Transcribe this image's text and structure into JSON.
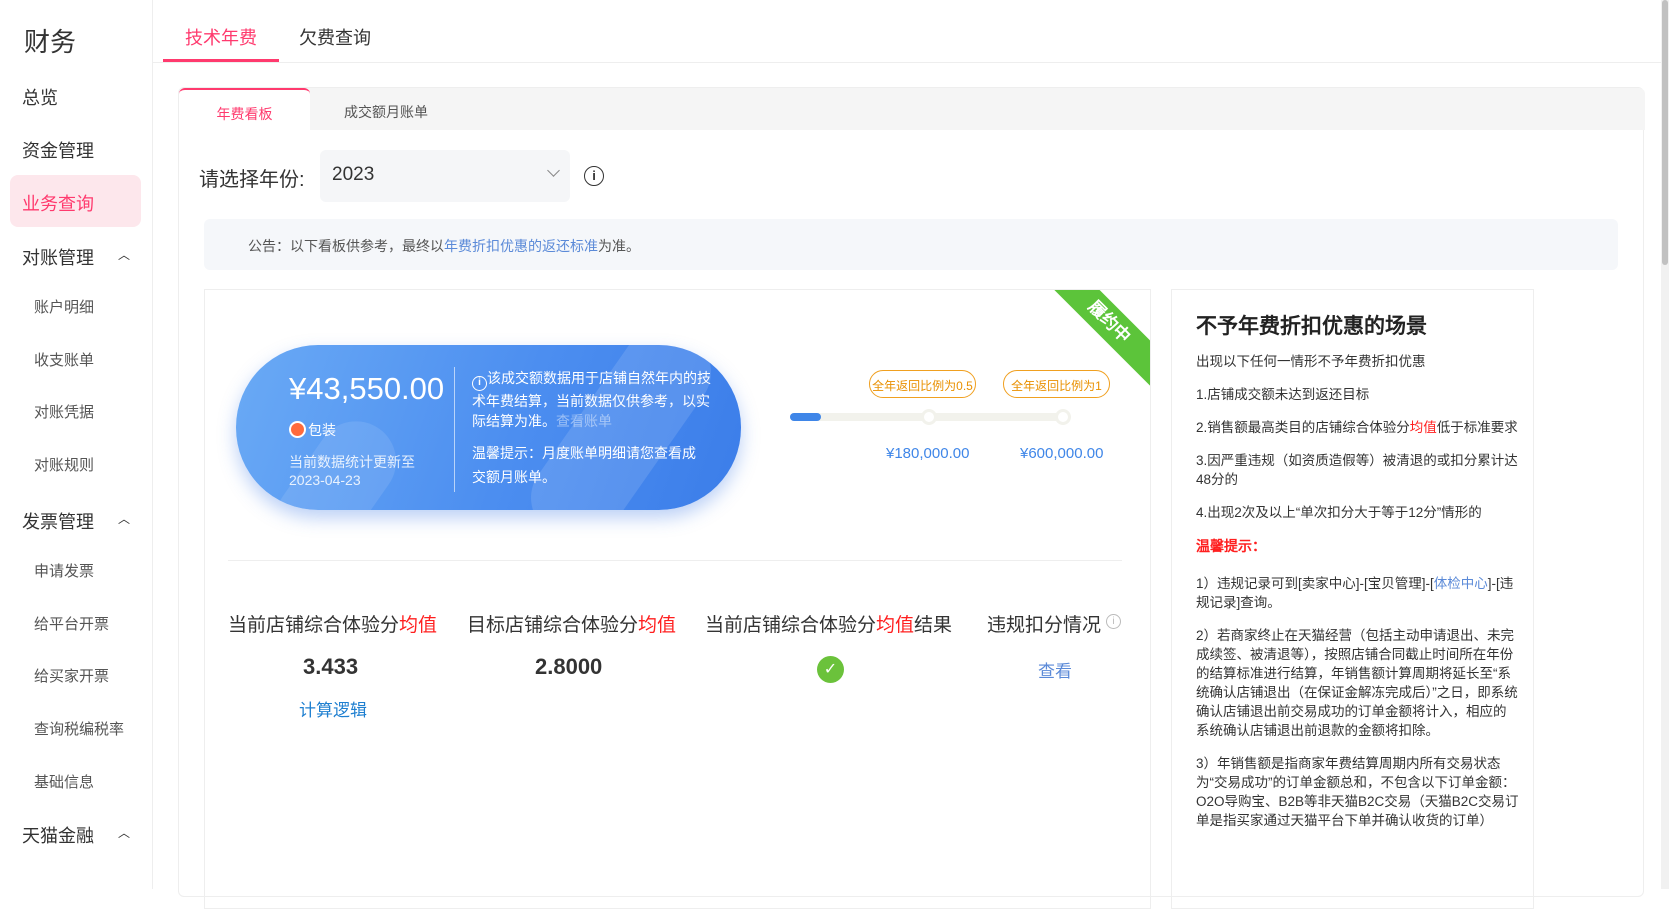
{
  "sidebar": {
    "title": "财务",
    "items": [
      "总览",
      "资金管理",
      "业务查询"
    ],
    "groups": [
      {
        "label": "对账管理",
        "children": [
          "账户明细",
          "收支账单",
          "对账凭据",
          "对账规则"
        ]
      },
      {
        "label": "发票管理",
        "children": [
          "申请发票",
          "给平台开票",
          "给买家开票",
          "查询税编税率",
          "基础信息"
        ]
      },
      {
        "label": "天猫金融"
      }
    ]
  },
  "top_tabs": [
    "技术年费",
    "欠费查询"
  ],
  "sub_tabs": [
    "年费看板",
    "成交额月账单"
  ],
  "year": {
    "label": "请选择年份:",
    "value": "2023"
  },
  "notice": {
    "prefix": "公告：以下看板供参考，最终以",
    "link": "年费折扣优惠的返还标准",
    "suffix": "为准。"
  },
  "status_ribbon": "履约中",
  "summary": {
    "amount": "¥43,550.00",
    "category": "包装",
    "updated_label": "当前数据统计更新至",
    "updated_date": "2023-04-23",
    "desc": "该成交额数据用于店铺自然年内的技术年费结算，当前数据仅供参考，以实际结算为准。",
    "desc_link": "查看账单",
    "tip": "温馨提示：月度账单明细请您查看成交额月账单。"
  },
  "progress": {
    "fraction": 0.11,
    "milestones": [
      {
        "label": "全年返回比例为0.5",
        "amount": "¥180,000.00"
      },
      {
        "label": "全年返回比例为1",
        "amount": "¥600,000.00"
      }
    ]
  },
  "metrics": {
    "current": {
      "label_a": "当前店铺综合体验分",
      "label_b": "均值",
      "value": "3.433",
      "link": "计算逻辑"
    },
    "target": {
      "label_a": "目标店铺综合体验分",
      "label_b": "均值",
      "value": "2.8000"
    },
    "result": {
      "label_a": "当前店铺综合体验分",
      "label_b": "均值",
      "label_c": "结果"
    },
    "violation": {
      "label": "违规扣分情况",
      "link": "查看"
    }
  },
  "side": {
    "title": "不予年费折扣优惠的场景",
    "intro": "出现以下任何一情形不予年费折扣优惠",
    "rule1": "1.店铺成交额未达到返还目标",
    "rule2a": "2.销售额最高类目的店铺综合体验分",
    "rule2b": "均值",
    "rule2c": "低于标准要求",
    "rule3": "3.因严重违规（如资质造假等）被清退的或扣分累计达48分的",
    "rule4": "4.出现2次及以上“单次扣分大于等于12分”情形的",
    "warm_title": "温馨提示：",
    "note1a": "1）违规记录可到[卖家中心]-[宝贝管理]-[",
    "note1b": "体检中心",
    "note1c": "]-[违规记录]查询。",
    "note2": "2）若商家终止在天猫经营（包括主动申请退出、未完成续签、被清退等），按照店铺合同截止时间所在年份的结算标准进行结算，年销售额计算周期将延长至“系统确认店铺退出（在保证金解冻完成后）”之日，即系统确认店铺退出前交易成功的订单金额将计入，相应的系统确认店铺退出前退款的金额将扣除。",
    "note3": "3）年销售额是指商家年费结算周期内所有交易状态为“交易成功”的订单金额总和，不包含以下订单金额：O2O导购宝、B2B等非天猫B2C交易（天猫B2C交易订单是指买家通过天猫平台下单并确认收货的订单）"
  },
  "colors": {
    "accent": "#ff3a6e",
    "blue": "#3f86e8",
    "green": "#5cc43a",
    "orange": "#e99000"
  }
}
